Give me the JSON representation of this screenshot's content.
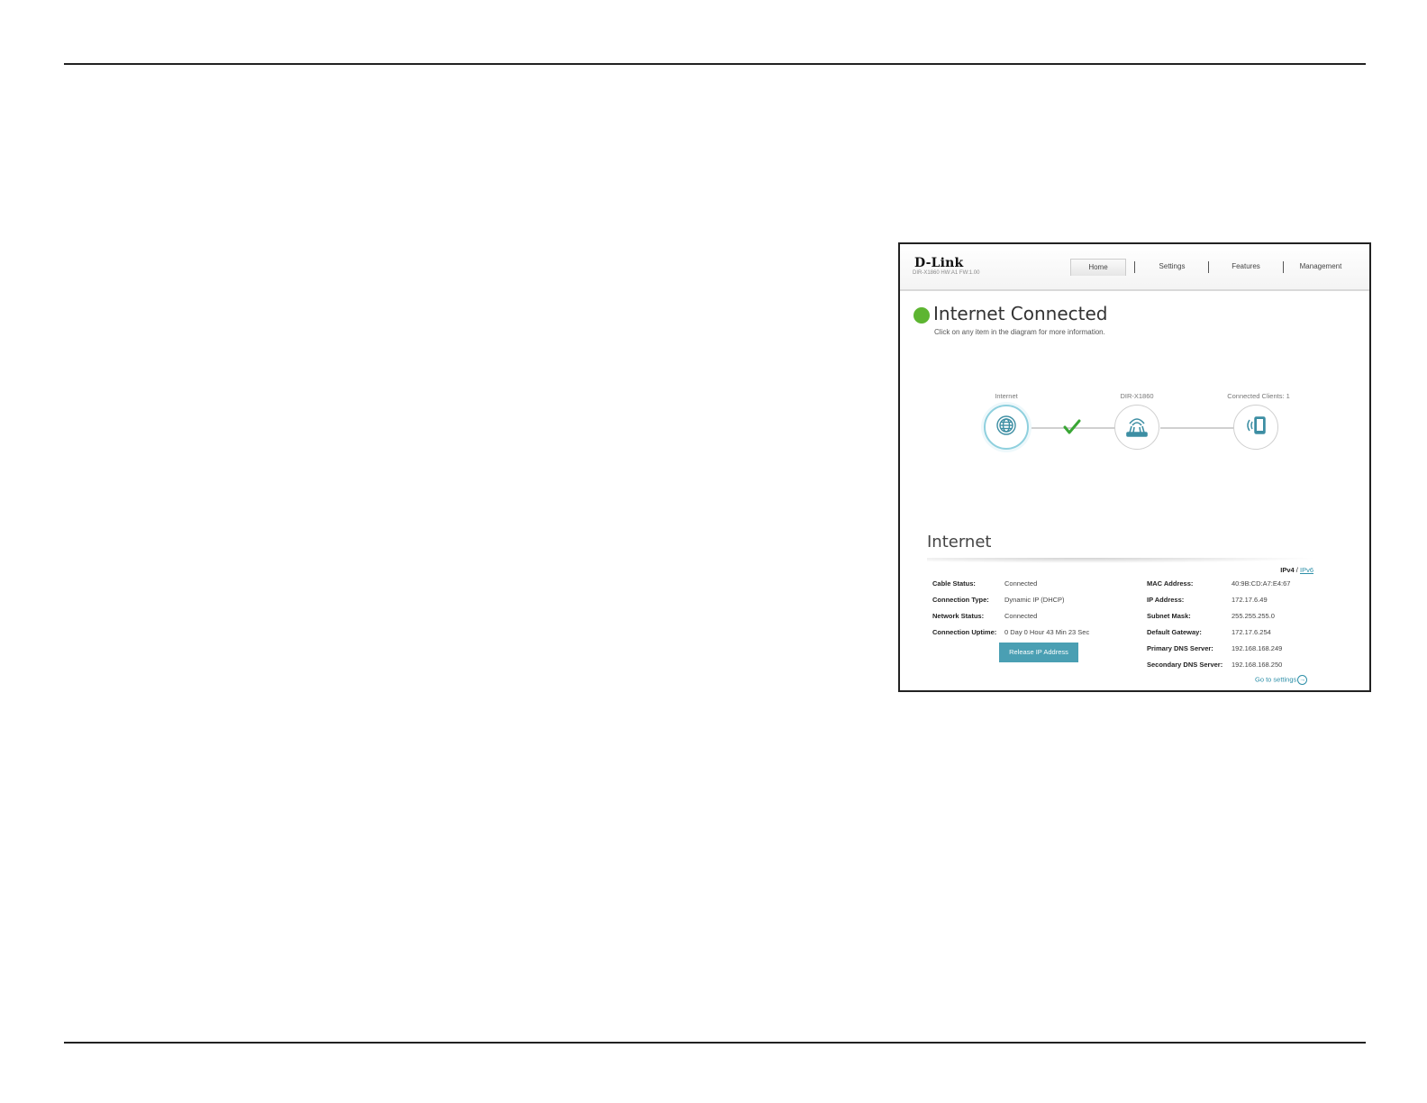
{
  "header": {
    "logo": "D-Link",
    "model": "DIR-X1860 HW:A1 FW:1.00",
    "nav": [
      {
        "label": "Home",
        "active": true
      },
      {
        "label": "Settings",
        "active": false
      },
      {
        "label": "Features",
        "active": false
      },
      {
        "label": "Management",
        "active": false
      }
    ]
  },
  "status": {
    "title": "Internet Connected",
    "subtitle": "Click on any item in the diagram for more information.",
    "color": "#5db531"
  },
  "diagram": {
    "nodes": [
      {
        "label": "Internet",
        "icon": "globe-icon"
      },
      {
        "label": "DIR-X1860",
        "icon": "router-icon"
      },
      {
        "label": "Connected Clients: 1",
        "icon": "client-device-icon"
      }
    ],
    "link_icon": "checkmark-icon"
  },
  "internet": {
    "title": "Internet",
    "ipv4": "IPv4",
    "sep": "/",
    "ipv6": "IPv6",
    "left": [
      {
        "key": "Cable Status:",
        "value": "Connected"
      },
      {
        "key": "Connection Type:",
        "value": "Dynamic IP (DHCP)"
      },
      {
        "key": "Network Status:",
        "value": "Connected"
      },
      {
        "key": "Connection Uptime:",
        "value": "0 Day 0 Hour 43 Min 23 Sec"
      }
    ],
    "right": [
      {
        "key": "MAC Address:",
        "value": "40:9B:CD:A7:E4:67"
      },
      {
        "key": "IP Address:",
        "value": "172.17.6.49"
      },
      {
        "key": "Subnet Mask:",
        "value": "255.255.255.0"
      },
      {
        "key": "Default Gateway:",
        "value": "172.17.6.254"
      },
      {
        "key": "Primary DNS Server:",
        "value": "192.168.168.249"
      },
      {
        "key": "Secondary DNS Server:",
        "value": "192.168.168.250"
      }
    ],
    "release_button": "Release IP Address",
    "goto_settings": "Go to settings",
    "accent": "#4a9fb3"
  }
}
